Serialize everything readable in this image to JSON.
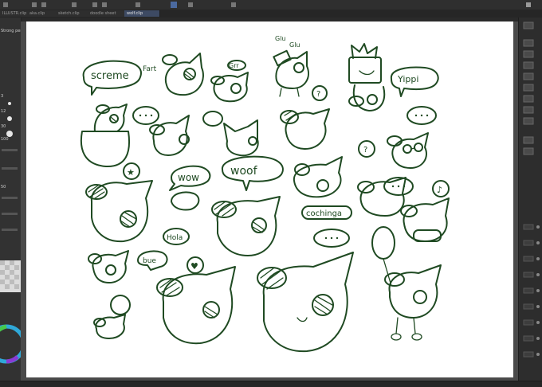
{
  "tabs": [
    {
      "label": "ILLUSTR.clip",
      "active": false
    },
    {
      "label": "aka.clip",
      "active": false
    },
    {
      "label": "sketch.clip",
      "active": false
    },
    {
      "label": "doodle sheet",
      "active": false
    },
    {
      "label": "wolf.clip",
      "active": true
    }
  ],
  "left_panel": {
    "tool_label": "Strong pen",
    "size_values": [
      "3",
      "12",
      "30",
      "100"
    ],
    "zoom_label": "50"
  },
  "canvas_text": {
    "screeme": "screme",
    "fart": "Fart",
    "grr": "Grr",
    "glu": "Glu",
    "glu2": "Glu",
    "yippi": "Yippi",
    "woof": "woof",
    "wow": "wow",
    "cochinga": "cochinga",
    "hola": "Hola",
    "bne": "bue",
    "question": "?",
    "question2": "?",
    "music": "♪",
    "heart": "♥",
    "star": "★"
  },
  "colors": {
    "ink": "#1f4a22",
    "canvas": "#ffffff",
    "ui_dark": "#2d2d2d",
    "accent_tab": "#3d4a63"
  }
}
